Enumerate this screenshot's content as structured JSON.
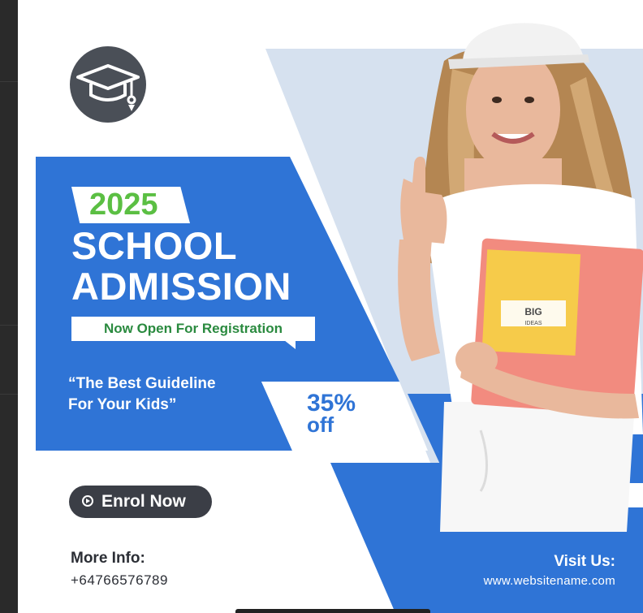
{
  "flyer": {
    "year": "2025",
    "title_line1": "SCHOOL",
    "title_line2": "ADMISSION",
    "registration": "Now Open For Registration",
    "quote_line1": "“The Best Guideline",
    "quote_line2": "For Your Kids”",
    "discount_value": "35%",
    "discount_suffix": "off",
    "cta_label": "Enrol Now",
    "more_info_label": "More Info:",
    "phone": "+64766576789",
    "visit_label": "Visit Us:",
    "website": "www.websitename.com",
    "folder_text_line1": "BIG",
    "folder_text_line2": "IDEAS"
  },
  "icons": {
    "logo": "graduation-cap-icon",
    "cta": "play-circle-icon"
  },
  "colors": {
    "primary_blue": "#2f74d6",
    "light_blue": "#d6e1ef",
    "accent_green": "#5bbf43",
    "dark": "#3b3e46",
    "background": "#ffffff"
  }
}
